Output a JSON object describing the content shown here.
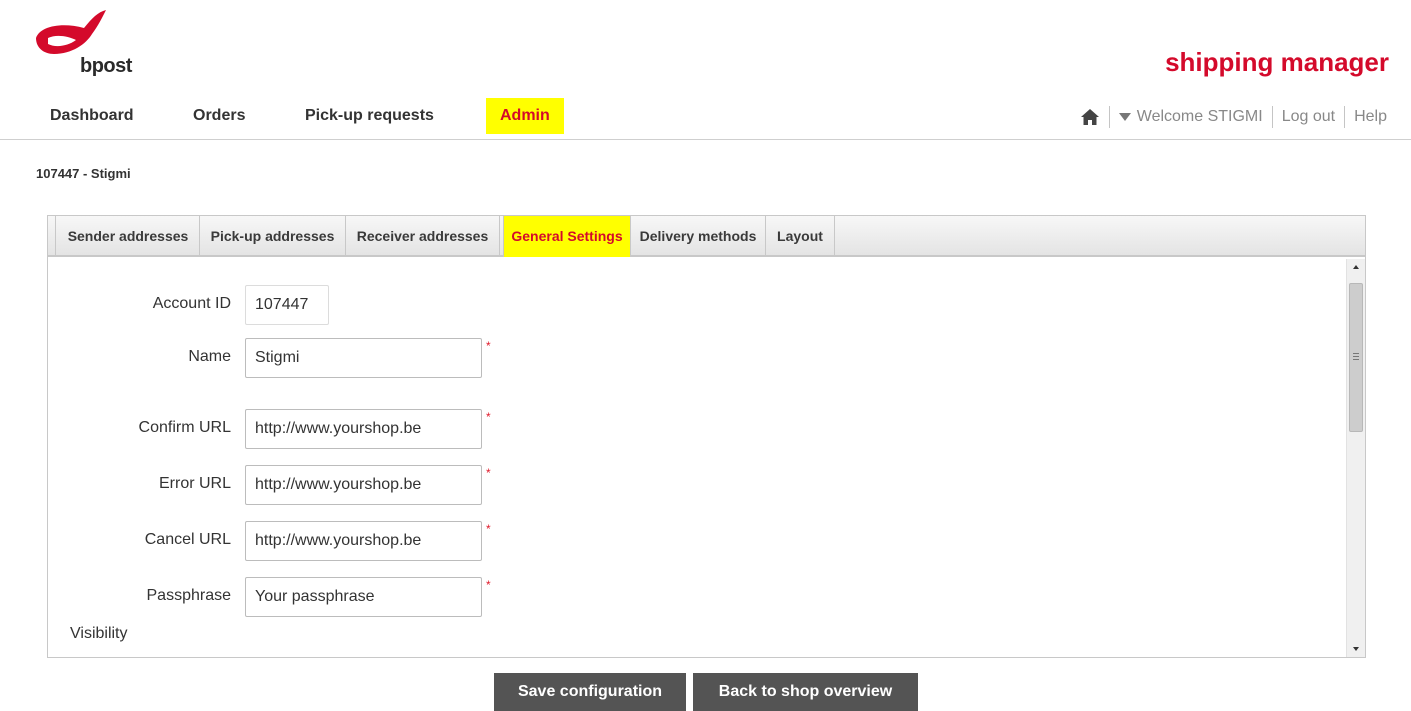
{
  "header": {
    "logo_text": "bpost",
    "app_title": "shipping manager"
  },
  "nav": {
    "items": [
      {
        "label": "Dashboard"
      },
      {
        "label": "Orders"
      },
      {
        "label": "Pick-up requests"
      },
      {
        "label": "Admin",
        "active": true
      }
    ],
    "welcome": "Welcome STIGMI",
    "logout": "Log out",
    "help": "Help"
  },
  "account_heading": "107447 - Stigmi",
  "tabs": [
    {
      "label": "Sender addresses"
    },
    {
      "label": "Pick-up addresses"
    },
    {
      "label": "Receiver addresses"
    },
    {
      "label": "General Settings",
      "active": true
    },
    {
      "label": "Delivery methods"
    },
    {
      "label": "Layout"
    }
  ],
  "form": {
    "account_id": {
      "label": "Account ID",
      "value": "107447"
    },
    "name": {
      "label": "Name",
      "value": "Stigmi"
    },
    "confirm_url": {
      "label": "Confirm URL",
      "value": "http://www.yourshop.be"
    },
    "error_url": {
      "label": "Error URL",
      "value": "http://www.yourshop.be"
    },
    "cancel_url": {
      "label": "Cancel URL",
      "value": "http://www.yourshop.be"
    },
    "passphrase": {
      "label": "Passphrase",
      "value": "Your passphrase"
    },
    "visibility_label": "Visibility",
    "required_marker": "*"
  },
  "actions": {
    "save": "Save configuration",
    "back": "Back to shop overview"
  },
  "colors": {
    "brand_red": "#d40a2b",
    "highlight": "#ffff00",
    "button_bg": "#545454"
  }
}
